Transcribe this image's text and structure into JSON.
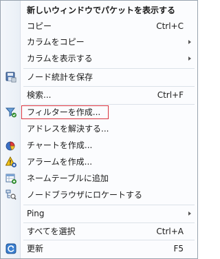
{
  "menu": {
    "open_new_window": "新しいウィンドウでパケットを表示する",
    "copy": "コピー",
    "copy_shortcut": "Ctrl+C",
    "copy_column": "カラムをコピー",
    "show_column": "カラムを表示する",
    "save_node_stats": "ノード統計を保存",
    "search": "検索...",
    "search_shortcut": "Ctrl+F",
    "create_filter": "フィルターを作成...",
    "resolve_address": "アドレスを解決する...",
    "create_chart": "チャートを作成...",
    "create_alarm": "アラームを作成...",
    "add_name_table": "ネームテーブルに追加",
    "locate_node_browser": "ノードブラウザにロケートする",
    "ping": "Ping",
    "select_all": "すべてを選択",
    "select_all_shortcut": "Ctrl+A",
    "refresh": "更新",
    "refresh_shortcut": "F5"
  },
  "icons": {
    "save_node_stats": "save-disk-icon",
    "create_filter": "filter-funnel-icon",
    "create_chart": "chart-icon",
    "create_alarm": "alarm-warning-icon",
    "add_name_table": "name-table-add-icon",
    "locate_node_browser": "node-browser-locate-icon",
    "refresh": "refresh-icon"
  },
  "colors": {
    "highlight_border": "#d9313c",
    "text": "#1a1a1a"
  }
}
